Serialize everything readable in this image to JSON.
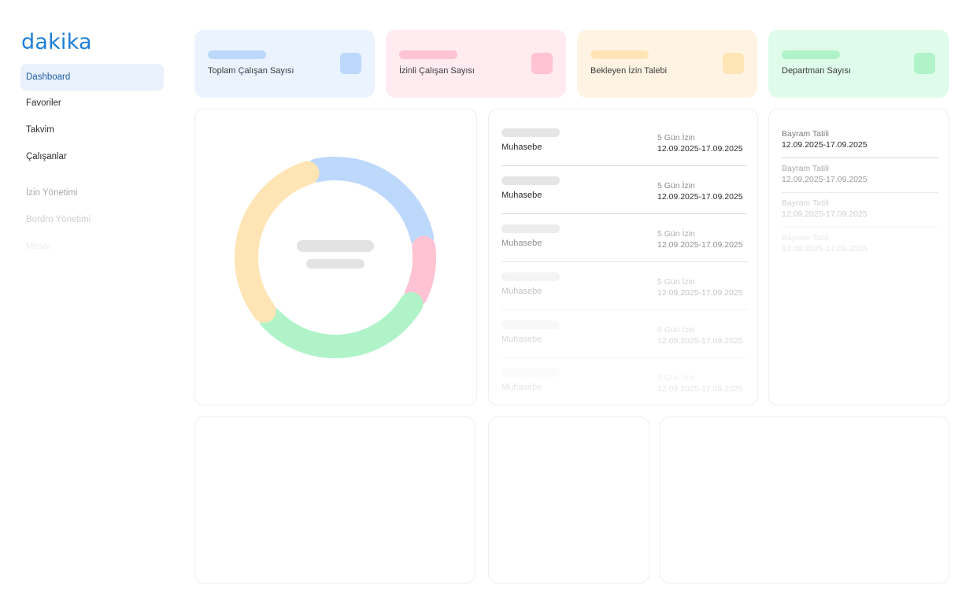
{
  "app": {
    "logo": "dakika"
  },
  "sidebar": {
    "items": [
      {
        "label": "Dashboard"
      },
      {
        "label": "Favoriler"
      },
      {
        "label": "Takvim"
      },
      {
        "label": "Çalışanlar"
      },
      {
        "label": "İzin Yönetimi"
      },
      {
        "label": "Bordro Yönetimi"
      },
      {
        "label": "Mesai"
      }
    ]
  },
  "stats": [
    {
      "label": "Toplam Çalışan Sayısı",
      "color": "#bcd8fb",
      "bg": "#eaf3fe"
    },
    {
      "label": "İzinli Çalışan Sayısı",
      "color": "#ffc3d3",
      "bg": "#ffebf0"
    },
    {
      "label": "Bekleyen İzin Talebi",
      "color": "#ffe4b5",
      "bg": "#fff4e4"
    },
    {
      "label": "Departman Sayısı",
      "color": "#b0f3c8",
      "bg": "#dffbea"
    }
  ],
  "leave_requests": [
    {
      "department": "Muhasebe",
      "days": "5 Gün İzin",
      "range": "12.09.2025-17.09.2025"
    },
    {
      "department": "Muhasebe",
      "days": "5 Gün İzin",
      "range": "12.09.2025-17.09.2025"
    },
    {
      "department": "Muhasebe",
      "days": "5 Gün İzin",
      "range": "12.09.2025-17.09.2025"
    },
    {
      "department": "Muhasebe",
      "days": "5 Gün İzin",
      "range": "12.09.2025-17.09.2025"
    },
    {
      "department": "Muhasebe",
      "days": "5 Gün İzin",
      "range": "12.09.2025-17.09.2025"
    },
    {
      "department": "Muhasebe",
      "days": "5 Gün İzin",
      "range": "12.09.2025-17.09.2025"
    }
  ],
  "holidays": [
    {
      "name": "Bayram Tatili",
      "range": "12.09.2025-17.09.2025"
    },
    {
      "name": "Bayram Tatili",
      "range": "12.09.2025-17.09.2025"
    },
    {
      "name": "Bayram Tatili",
      "range": "12.09.2025-17.09.2025"
    },
    {
      "name": "Bayram Tatili",
      "range": "12.09.2025-17.09.2025"
    }
  ],
  "donut": {
    "segments": [
      {
        "share": 0.265,
        "color": "#bcd8fb"
      },
      {
        "share": 0.105,
        "color": "#ffc3d3"
      },
      {
        "share": 0.31,
        "color": "#b0f3c8"
      },
      {
        "share": 0.32,
        "color": "#ffe4b5"
      }
    ]
  }
}
